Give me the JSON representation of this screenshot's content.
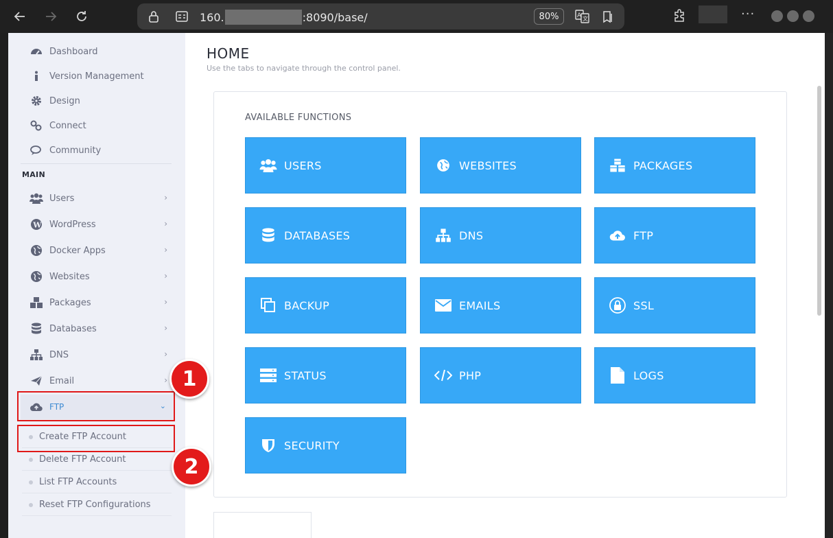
{
  "browser": {
    "url_prefix": "160.",
    "url_suffix": ":8090/base/",
    "zoom": "80%",
    "more": "···"
  },
  "sidebar": {
    "top_items": [
      {
        "label": "Dashboard",
        "icon": "dashboard-icon"
      },
      {
        "label": "Version Management",
        "icon": "info-icon"
      },
      {
        "label": "Design",
        "icon": "gear-icon"
      },
      {
        "label": "Connect",
        "icon": "link-icon"
      },
      {
        "label": "Community",
        "icon": "chat-icon"
      }
    ],
    "section_label": "MAIN",
    "main_items": [
      {
        "label": "Users",
        "icon": "users-icon"
      },
      {
        "label": "WordPress",
        "icon": "wordpress-icon"
      },
      {
        "label": "Docker Apps",
        "icon": "globe-icon"
      },
      {
        "label": "Websites",
        "icon": "globe-icon"
      },
      {
        "label": "Packages",
        "icon": "cubes-icon"
      },
      {
        "label": "Databases",
        "icon": "database-icon"
      },
      {
        "label": "DNS",
        "icon": "sitemap-icon"
      },
      {
        "label": "Email",
        "icon": "paper-plane-icon"
      }
    ],
    "ftp": {
      "label": "FTP",
      "icon": "cloud-upload-icon",
      "subitems": [
        "Create FTP Account",
        "Delete FTP Account",
        "List FTP Accounts",
        "Reset FTP Configurations"
      ]
    }
  },
  "annotations": {
    "step1": "1",
    "step2": "2",
    "highlight_color": "#e01818"
  },
  "main": {
    "title": "HOME",
    "subtitle": "Use the tabs to navigate through the control panel.",
    "panel_title": "AVAILABLE FUNCTIONS",
    "tile_color": "#37a8f7",
    "tiles": [
      {
        "label": "USERS",
        "icon": "users-icon"
      },
      {
        "label": "WEBSITES",
        "icon": "globe-icon"
      },
      {
        "label": "PACKAGES",
        "icon": "cubes-icon"
      },
      {
        "label": "DATABASES",
        "icon": "database-icon"
      },
      {
        "label": "DNS",
        "icon": "sitemap-icon"
      },
      {
        "label": "FTP",
        "icon": "cloud-upload-icon"
      },
      {
        "label": "BACKUP",
        "icon": "copy-icon"
      },
      {
        "label": "EMAILS",
        "icon": "envelope-icon"
      },
      {
        "label": "SSL",
        "icon": "lock-icon"
      },
      {
        "label": "STATUS",
        "icon": "server-icon"
      },
      {
        "label": "PHP",
        "icon": "code-icon"
      },
      {
        "label": "LOGS",
        "icon": "file-icon"
      },
      {
        "label": "SECURITY",
        "icon": "shield-icon"
      }
    ]
  }
}
